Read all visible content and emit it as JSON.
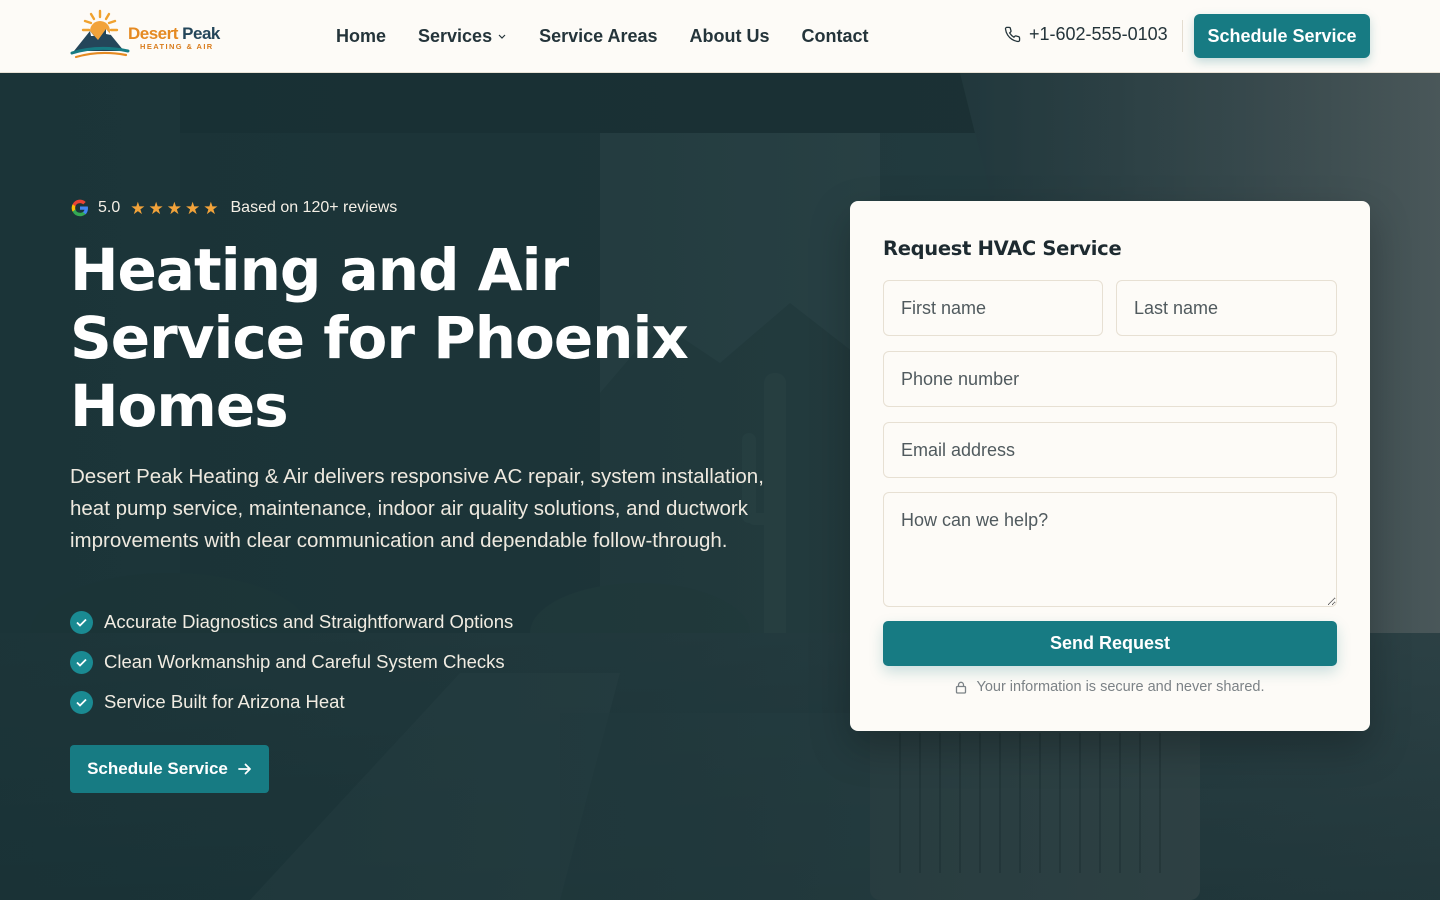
{
  "brand": {
    "name_part1": "Desert",
    "name_part2": "Peak",
    "tagline": "HEATING & AIR",
    "colors": {
      "primary": "#177b83",
      "accent": "#e58a22",
      "navy": "#24465a",
      "star": "#f2a33a"
    }
  },
  "nav": {
    "items": [
      {
        "label": "Home"
      },
      {
        "label": "Services",
        "has_dropdown": true
      },
      {
        "label": "Service Areas"
      },
      {
        "label": "About Us"
      },
      {
        "label": "Contact"
      }
    ],
    "phone": "+1-602-555-0103",
    "cta": "Schedule Service"
  },
  "hero": {
    "rating": {
      "score": "5.0",
      "stars": 5,
      "reviews_text": "Based on 120+ reviews",
      "icon": "google-icon"
    },
    "title": "Heating and Air Service for Phoenix Homes",
    "description": "Desert Peak Heating & Air delivers responsive AC repair, system installation, heat pump service, maintenance, indoor air quality solutions, and ductwork improvements with clear communication and dependable follow-through.",
    "benefits": [
      "Accurate Diagnostics and Straightforward Options",
      "Clean Workmanship and Careful System Checks",
      "Service Built for Arizona Heat"
    ],
    "cta": "Schedule Service"
  },
  "form": {
    "title": "Request HVAC Service",
    "first_name_placeholder": "First name",
    "last_name_placeholder": "Last name",
    "phone_placeholder": "Phone number",
    "email_placeholder": "Email address",
    "message_placeholder": "How can we help?",
    "submit": "Send Request",
    "secure_note": "Your information is secure and never shared."
  }
}
